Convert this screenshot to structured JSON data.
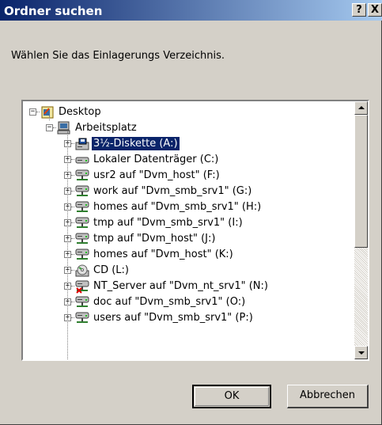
{
  "window": {
    "title": "Ordner suchen",
    "help_label": "?",
    "close_label": "X"
  },
  "description": "Wählen Sie das Einlagerungs Verzeichnis.",
  "tree": {
    "items": [
      {
        "label": "Desktop",
        "icon": "desktop-icon",
        "expanded": true,
        "selected": false
      },
      {
        "label": "Arbeitsplatz",
        "icon": "computer-icon",
        "expanded": true,
        "selected": false
      },
      {
        "label": "3½-Diskette (A:)",
        "icon": "floppy-drive-icon",
        "expanded": false,
        "selected": true
      },
      {
        "label": "Lokaler Datenträger (C:)",
        "icon": "hard-drive-icon",
        "expanded": false,
        "selected": false
      },
      {
        "label": "usr2 auf \"Dvm_host\" (F:)",
        "icon": "network-drive-icon",
        "expanded": false,
        "selected": false
      },
      {
        "label": "work auf \"Dvm_smb_srv1\" (G:)",
        "icon": "network-drive-icon",
        "expanded": false,
        "selected": false
      },
      {
        "label": "homes auf \"Dvm_smb_srv1\" (H:)",
        "icon": "network-drive-icon",
        "expanded": false,
        "selected": false
      },
      {
        "label": "tmp auf \"Dvm_smb_srv1\" (I:)",
        "icon": "network-drive-icon",
        "expanded": false,
        "selected": false
      },
      {
        "label": "tmp auf \"Dvm_host\" (J:)",
        "icon": "network-drive-icon",
        "expanded": false,
        "selected": false
      },
      {
        "label": "homes auf \"Dvm_host\" (K:)",
        "icon": "network-drive-icon",
        "expanded": false,
        "selected": false
      },
      {
        "label": "CD (L:)",
        "icon": "cd-drive-icon",
        "expanded": false,
        "selected": false
      },
      {
        "label": "NT_Server auf \"Dvm_nt_srv1\" (N:)",
        "icon": "disconnected-network-drive-icon",
        "expanded": false,
        "selected": false
      },
      {
        "label": "doc auf \"Dvm_smb_srv1\" (O:)",
        "icon": "network-drive-icon",
        "expanded": false,
        "selected": false
      },
      {
        "label": "users auf \"Dvm_smb_srv1\" (P:)",
        "icon": "network-drive-icon",
        "expanded": false,
        "selected": false
      }
    ]
  },
  "buttons": {
    "ok_label": "OK",
    "cancel_label": "Abbrechen"
  }
}
